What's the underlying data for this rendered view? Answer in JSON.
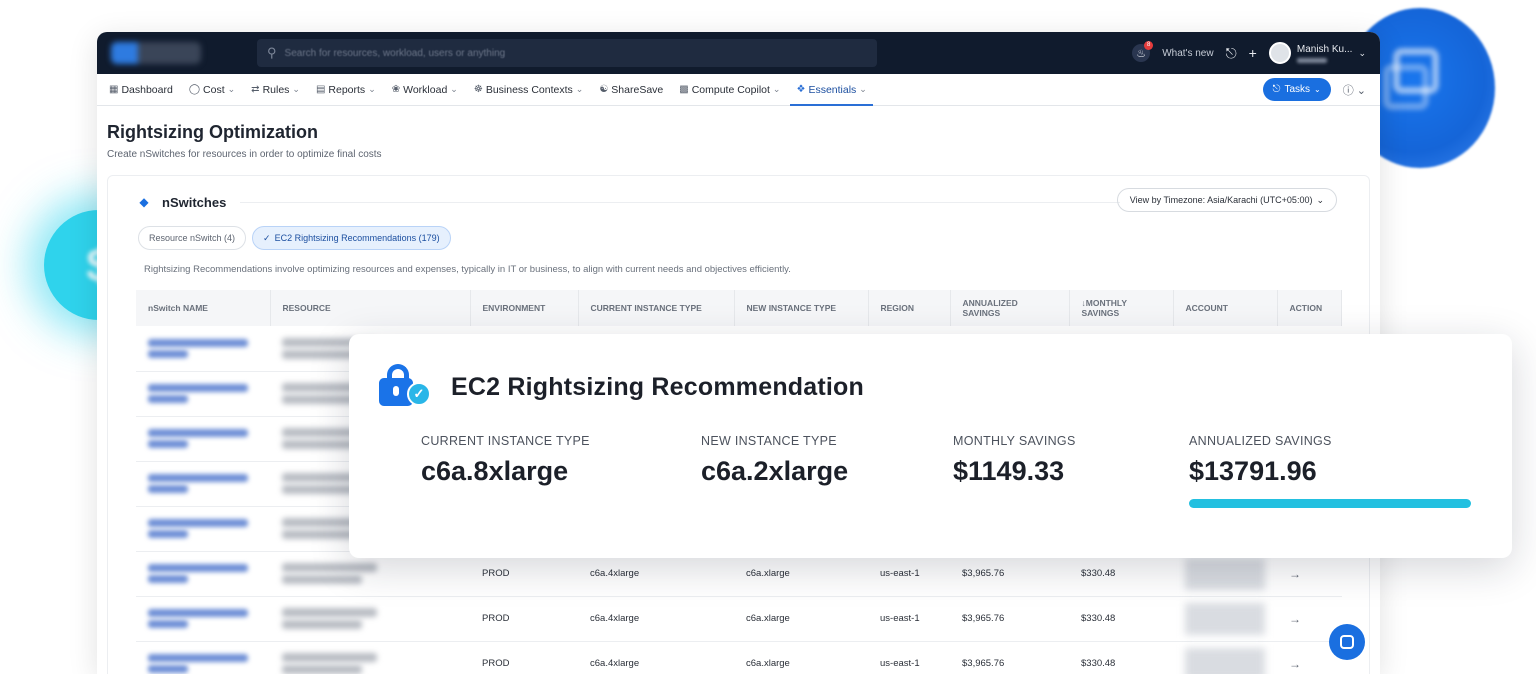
{
  "topbar": {
    "search_placeholder": "Search for resources, workload, users or anything",
    "whats_new": "What's new",
    "notification_count": "8",
    "user_name": "Manish Ku..."
  },
  "nav": {
    "items": [
      {
        "label": "Dashboard",
        "icon": "grid-icon"
      },
      {
        "label": "Cost",
        "icon": "dollar-icon"
      },
      {
        "label": "Rules",
        "icon": "rules-icon"
      },
      {
        "label": "Reports",
        "icon": "report-icon"
      },
      {
        "label": "Workload",
        "icon": "cube-icon"
      },
      {
        "label": "Business Contexts",
        "icon": "people-icon"
      },
      {
        "label": "ShareSave",
        "icon": "share-icon"
      },
      {
        "label": "Compute Copilot",
        "icon": "copilot-icon"
      },
      {
        "label": "Essentials",
        "icon": "essentials-icon"
      }
    ],
    "tasks_label": "Tasks",
    "active_item": "Essentials"
  },
  "page": {
    "title": "Rightsizing Optimization",
    "subtitle": "Create nSwitches for resources in order to optimize final costs"
  },
  "card": {
    "title": "nSwitches",
    "timezone_button": "View by Timezone: Asia/Karachi (UTC+05:00)",
    "tabs": [
      {
        "label": "Resource nSwitch (4)",
        "active": false
      },
      {
        "label": "EC2 Rightsizing Recommendations (179)",
        "active": true
      }
    ],
    "description": "Rightsizing Recommendations involve optimizing resources and expenses, typically in IT or business, to align with current needs and objectives efficiently."
  },
  "table": {
    "columns": [
      "nSwitch NAME",
      "RESOURCE",
      "ENVIRONMENT",
      "CURRENT INSTANCE TYPE",
      "NEW INSTANCE TYPE",
      "REGION",
      "ANNUALIZED SAVINGS",
      "MONTHLY SAVINGS",
      "ACCOUNT",
      "ACTION"
    ],
    "sort_column": "MONTHLY SAVINGS",
    "rows": [
      {
        "environment": "PROD",
        "current": "c6a.4xlarge",
        "new": "c6a.xlarge",
        "region": "us-east-1",
        "annualized": "$3,965.76",
        "monthly": "$330.48"
      },
      {
        "environment": "PROD",
        "current": "c6a.4xlarge",
        "new": "c6a.xlarge",
        "region": "us-east-1",
        "annualized": "$3,965.76",
        "monthly": "$330.48"
      },
      {
        "environment": "PROD",
        "current": "c6a.4xlarge",
        "new": "c6a.xlarge",
        "region": "us-east-1",
        "annualized": "$3,965.76",
        "monthly": "$330.48"
      }
    ]
  },
  "overlay": {
    "title": "EC2 Rightsizing Recommendation",
    "current_label": "CURRENT INSTANCE TYPE",
    "current_value": "c6a.8xlarge",
    "new_label": "NEW INSTANCE TYPE",
    "new_value": "c6a.2xlarge",
    "monthly_label": "MONTHLY SAVINGS",
    "monthly_value": "$1149.33",
    "annual_label": "ANNUALIZED SAVINGS",
    "annual_value": "$13791.96"
  },
  "colors": {
    "topbar": "#101b2d",
    "accent": "#1a6fe0",
    "savings_bar": "#23c0e0"
  }
}
